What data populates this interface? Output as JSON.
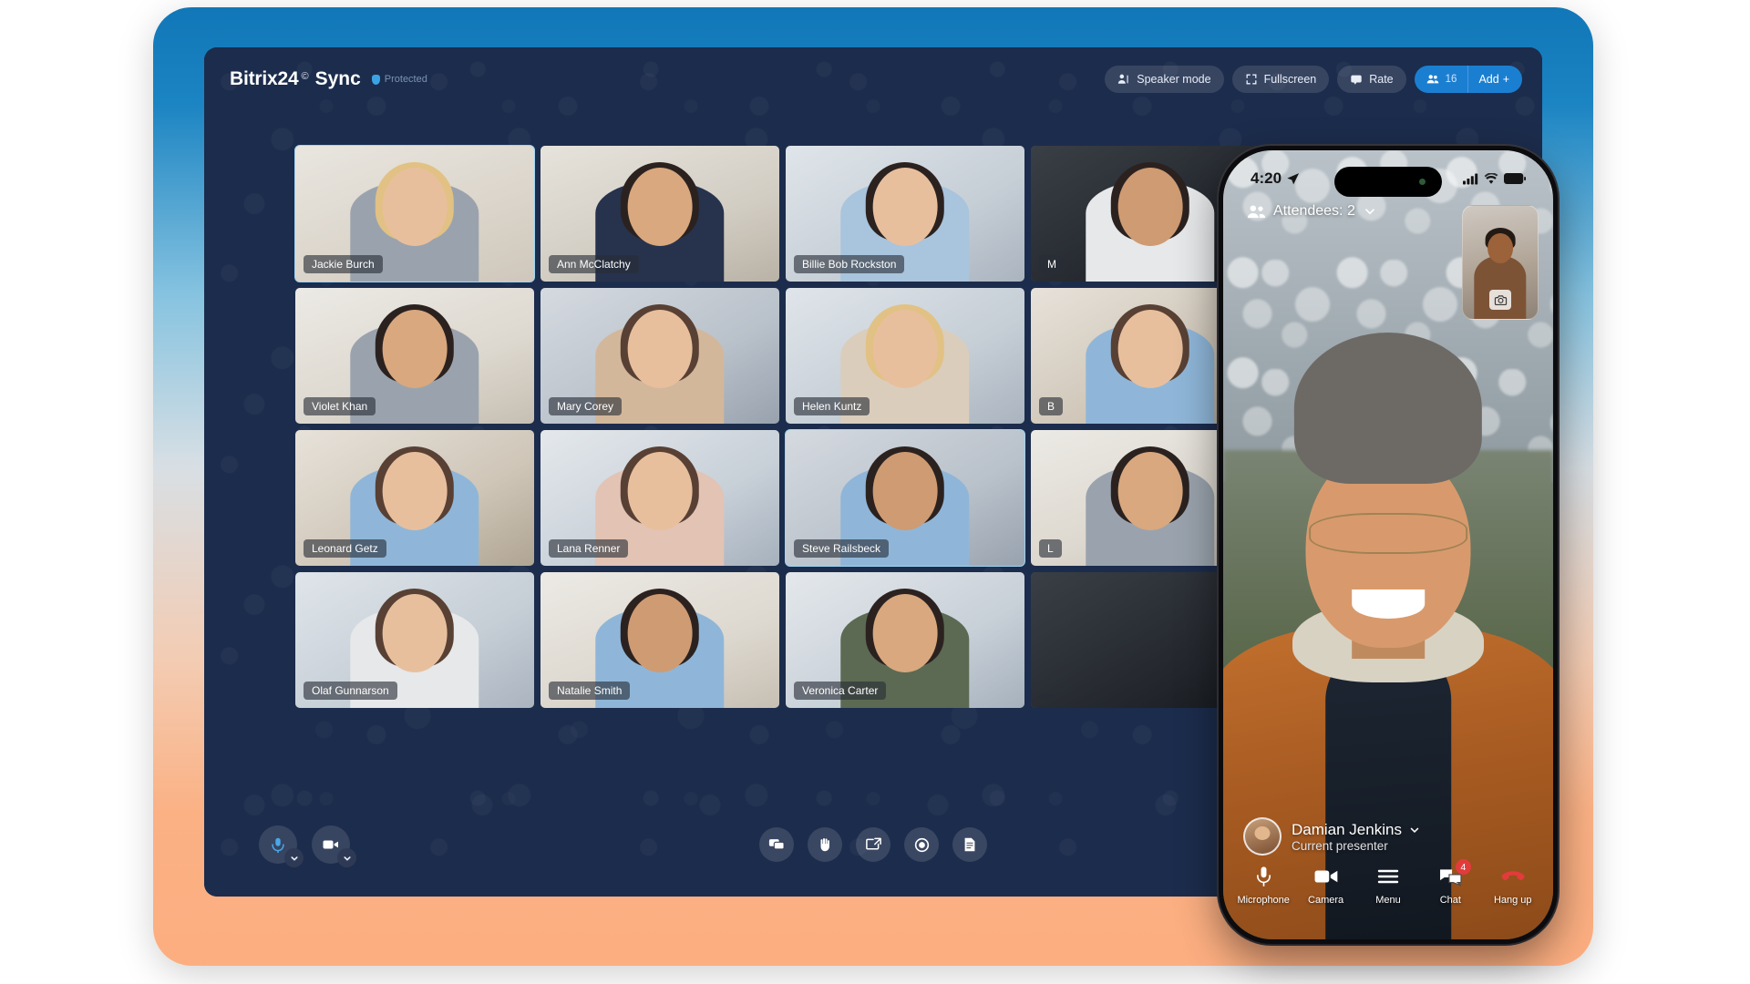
{
  "app": {
    "brand_name": "Bitrix24",
    "brand_reg": "©",
    "product_name": "Sync",
    "protected_label": "Protected"
  },
  "header": {
    "speaker_mode": "Speaker mode",
    "fullscreen": "Fullscreen",
    "rate": "Rate",
    "participant_count": "16",
    "add_label": "Add",
    "add_plus": "+"
  },
  "grid": {
    "tiles": [
      {
        "name": "Jackie Burch",
        "active": true
      },
      {
        "name": "Ann McClatchy",
        "active": false
      },
      {
        "name": "Billie Bob Rockston",
        "active": false
      },
      {
        "name": "M",
        "active": false
      },
      {
        "name": "Violet Khan",
        "active": false
      },
      {
        "name": "Mary Corey",
        "active": false
      },
      {
        "name": "Helen Kuntz",
        "active": false
      },
      {
        "name": "B",
        "active": false
      },
      {
        "name": "Leonard Getz",
        "active": false
      },
      {
        "name": "Lana Renner",
        "active": false
      },
      {
        "name": "Steve Railsbeck",
        "active": true
      },
      {
        "name": "L",
        "active": false
      },
      {
        "name": "Olaf Gunnarson",
        "active": false
      },
      {
        "name": "Natalie Smith",
        "active": false
      },
      {
        "name": "Veronica Carter",
        "active": false
      },
      {
        "name": "",
        "active": false
      }
    ]
  },
  "toolbar": {
    "microphone": "microphone-icon",
    "camera": "camera-icon",
    "chat": "chat-icon",
    "raise_hand": "raise-hand-icon",
    "screen_share": "screen-share-icon",
    "record": "record-icon",
    "notes": "notes-icon"
  },
  "phone": {
    "time": "4:20",
    "attendees_label": "Attendees: 2",
    "presenter_name": "Damian Jenkins",
    "presenter_role": "Current presenter",
    "controls": [
      {
        "label": "Microphone",
        "icon": "microphone-icon",
        "badge": ""
      },
      {
        "label": "Camera",
        "icon": "camera-icon",
        "badge": ""
      },
      {
        "label": "Menu",
        "icon": "menu-icon",
        "badge": ""
      },
      {
        "label": "Chat",
        "icon": "chat-icon",
        "badge": "4"
      },
      {
        "label": "Hang up",
        "icon": "hangup-icon",
        "badge": ""
      }
    ]
  },
  "colors": {
    "accent": "#1b7fd1",
    "app_bg": "#1c2c4c",
    "active_border": "#9fd4f2",
    "badge_red": "#e23b3b"
  }
}
